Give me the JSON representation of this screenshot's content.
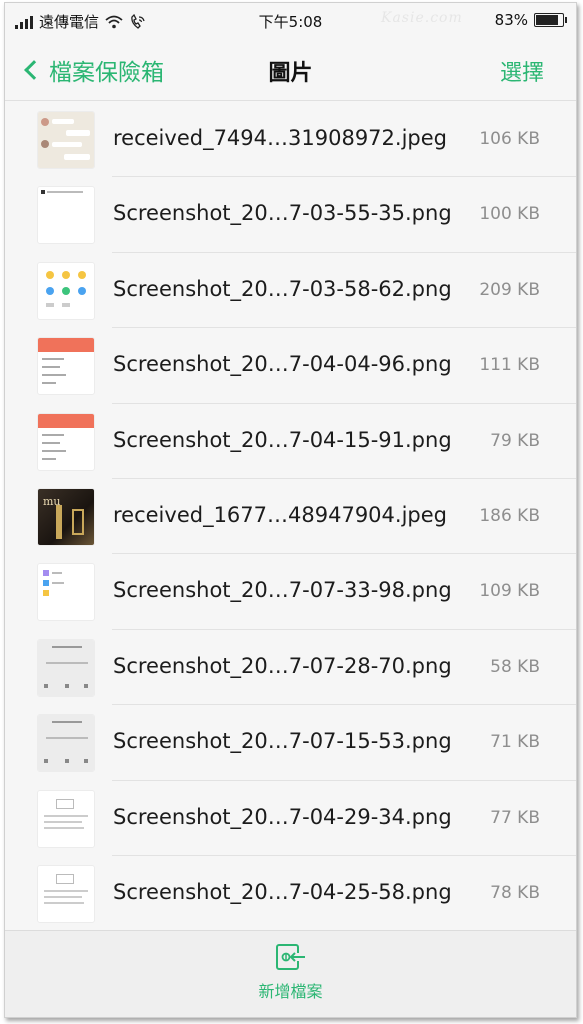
{
  "status_bar": {
    "carrier": "遠傳電信",
    "time": "下午5:08",
    "watermark": "Kasie.com",
    "battery": "83%",
    "battery_level": 0.83
  },
  "nav": {
    "back_label": "檔案保險箱",
    "title": "圖片",
    "select_label": "選擇"
  },
  "files": [
    {
      "name": "received_7494…31908972.jpeg",
      "size": "106 KB",
      "thumb": "chat"
    },
    {
      "name": "Screenshot_20…7-03-55-35.png",
      "size": "100 KB",
      "thumb": "white"
    },
    {
      "name": "Screenshot_20…7-03-58-62.png",
      "size": "209 KB",
      "thumb": "icons"
    },
    {
      "name": "Screenshot_20…7-04-04-96.png",
      "size": "111 KB",
      "thumb": "red"
    },
    {
      "name": "Screenshot_20…7-04-15-91.png",
      "size": "79 KB",
      "thumb": "red"
    },
    {
      "name": "received_1677…48947904.jpeg",
      "size": "186 KB",
      "thumb": "dark"
    },
    {
      "name": "Screenshot_20…7-07-33-98.png",
      "size": "109 KB",
      "thumb": "list"
    },
    {
      "name": "Screenshot_20…7-07-28-70.png",
      "size": "58 KB",
      "thumb": "gray"
    },
    {
      "name": "Screenshot_20…7-07-15-53.png",
      "size": "71 KB",
      "thumb": "gray"
    },
    {
      "name": "Screenshot_20…7-04-29-34.png",
      "size": "77 KB",
      "thumb": "doc"
    },
    {
      "name": "Screenshot_20…7-04-25-58.png",
      "size": "78 KB",
      "thumb": "doc"
    }
  ],
  "bottom": {
    "add_label": "新增檔案",
    "add_icon": "add-file-icon"
  },
  "colors": {
    "accent": "#2bb673",
    "background": "#f6f6f6",
    "divider": "#e2e2e2",
    "size_text": "#8e8e8e"
  }
}
